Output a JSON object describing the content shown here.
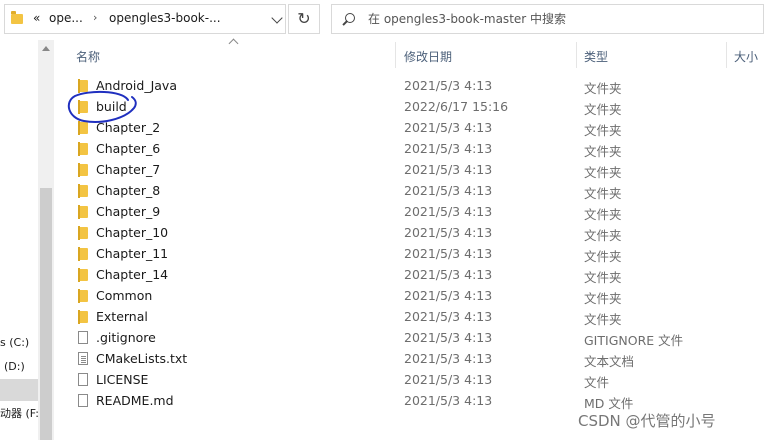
{
  "address": {
    "overflow": "«",
    "crumb1": "ope...",
    "crumb2": "opengles3-book-..."
  },
  "search": {
    "placeholder": "在 opengles3-book-master 中搜索"
  },
  "nav": {
    "items": [
      "s (C:)",
      "(D:)",
      "",
      "动器 (F:)"
    ]
  },
  "columns": {
    "name": "名称",
    "date": "修改日期",
    "type": "类型",
    "size": "大小"
  },
  "files": [
    {
      "name": "Android_Java",
      "date": "2021/5/3 4:13",
      "type": "文件夹",
      "icon": "folder-icon"
    },
    {
      "name": "build",
      "date": "2022/6/17 15:16",
      "type": "文件夹",
      "icon": "folder-icon"
    },
    {
      "name": "Chapter_2",
      "date": "2021/5/3 4:13",
      "type": "文件夹",
      "icon": "folder-icon"
    },
    {
      "name": "Chapter_6",
      "date": "2021/5/3 4:13",
      "type": "文件夹",
      "icon": "folder-icon"
    },
    {
      "name": "Chapter_7",
      "date": "2021/5/3 4:13",
      "type": "文件夹",
      "icon": "folder-icon"
    },
    {
      "name": "Chapter_8",
      "date": "2021/5/3 4:13",
      "type": "文件夹",
      "icon": "folder-icon"
    },
    {
      "name": "Chapter_9",
      "date": "2021/5/3 4:13",
      "type": "文件夹",
      "icon": "folder-icon"
    },
    {
      "name": "Chapter_10",
      "date": "2021/5/3 4:13",
      "type": "文件夹",
      "icon": "folder-icon"
    },
    {
      "name": "Chapter_11",
      "date": "2021/5/3 4:13",
      "type": "文件夹",
      "icon": "folder-icon"
    },
    {
      "name": "Chapter_14",
      "date": "2021/5/3 4:13",
      "type": "文件夹",
      "icon": "folder-icon"
    },
    {
      "name": "Common",
      "date": "2021/5/3 4:13",
      "type": "文件夹",
      "icon": "folder-icon"
    },
    {
      "name": "External",
      "date": "2021/5/3 4:13",
      "type": "文件夹",
      "icon": "folder-icon"
    },
    {
      "name": ".gitignore",
      "date": "2021/5/3 4:13",
      "type": "GITIGNORE 文件",
      "icon": "file-icon"
    },
    {
      "name": "CMakeLists.txt",
      "date": "2021/5/3 4:13",
      "type": "文本文档",
      "icon": "text-file-icon"
    },
    {
      "name": "LICENSE",
      "date": "2021/5/3 4:13",
      "type": "文件",
      "icon": "file-icon"
    },
    {
      "name": "README.md",
      "date": "2021/5/3 4:13",
      "type": "MD 文件",
      "icon": "file-icon"
    }
  ],
  "watermark": "CSDN @代管的小号",
  "colors": {
    "folder": "#f3c443",
    "header_text": "#4c607a",
    "annotation": "#1f2fbf"
  }
}
